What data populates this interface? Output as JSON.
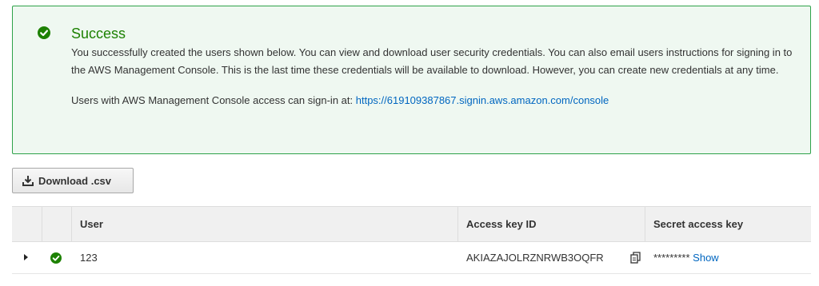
{
  "alert": {
    "title": "Success",
    "message": "You successfully created the users shown below. You can view and download user security credentials. You can also email users instructions for signing in to the AWS Management Console. This is the last time these credentials will be available to download. However, you can create new credentials at any time.",
    "signin_prefix": "Users with AWS Management Console access can sign-in at: ",
    "signin_url": "https://619109387867.signin.aws.amazon.com/console",
    "icon": "check-circle-icon",
    "color": "#1d8102"
  },
  "toolbar": {
    "download_label": "Download .csv",
    "download_icon": "download-icon"
  },
  "table": {
    "columns": [
      "",
      "",
      "User",
      "Access key ID",
      "Secret access key"
    ],
    "rows": [
      {
        "status_icon": "check-circle-icon",
        "user": "123",
        "access_key_id": "AKIAZAJOLRZNRWB3OQFR",
        "secret_masked": "*********",
        "secret_action": "Show"
      }
    ]
  }
}
